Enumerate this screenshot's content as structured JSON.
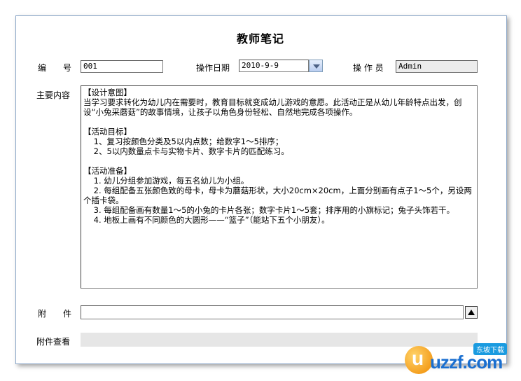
{
  "form": {
    "title": "教师笔记",
    "number_label": "编　　号",
    "number_value": "001",
    "date_label": "操作日期",
    "date_value": "2010-9-9",
    "operator_label": "操 作 员",
    "operator_value": "Admin",
    "content_label": "主要内容",
    "content_lines": [
      "【设计意图】",
      "当学习要求转化为幼儿内在需要时，教育目标就变成幼儿游戏的意愿。此活动正是从幼儿年龄特点出发，创设“小兔采蘑菇”的故事情境，让孩子以角色身份轻松、自然地完成各项操作。",
      "",
      "【活动目标】",
      "    1、复习按颜色分类及5以内点数；给数字1～5排序；",
      "    2、5以内数量点卡与实物卡片、数字卡片的匹配练习。",
      "",
      "【活动准备】",
      "    1. 幼儿分组参加游戏，每五名幼儿为小组。",
      "    2. 每组配备五张颜色致的母卡，母卡为蘑菇形状，大小20cm×20cm，上面分别画有点子1～5个，另设两个插卡袋。",
      "    3. 每组配备画有数量1～5的小兔的卡片各张；数字卡片1～5套；排序用的小旗标记；兔子头饰若干。",
      "    4. 地板上画有不同颜色的大圆形——“篮子”（能站下五个小朋友）。"
    ],
    "attachment_label": "附　　件",
    "attachment_value": "",
    "attachment_view_label": "附件查看"
  },
  "watermark": {
    "logo_letter": "u",
    "text": "uzzf.com",
    "tag": "东坡下载"
  }
}
